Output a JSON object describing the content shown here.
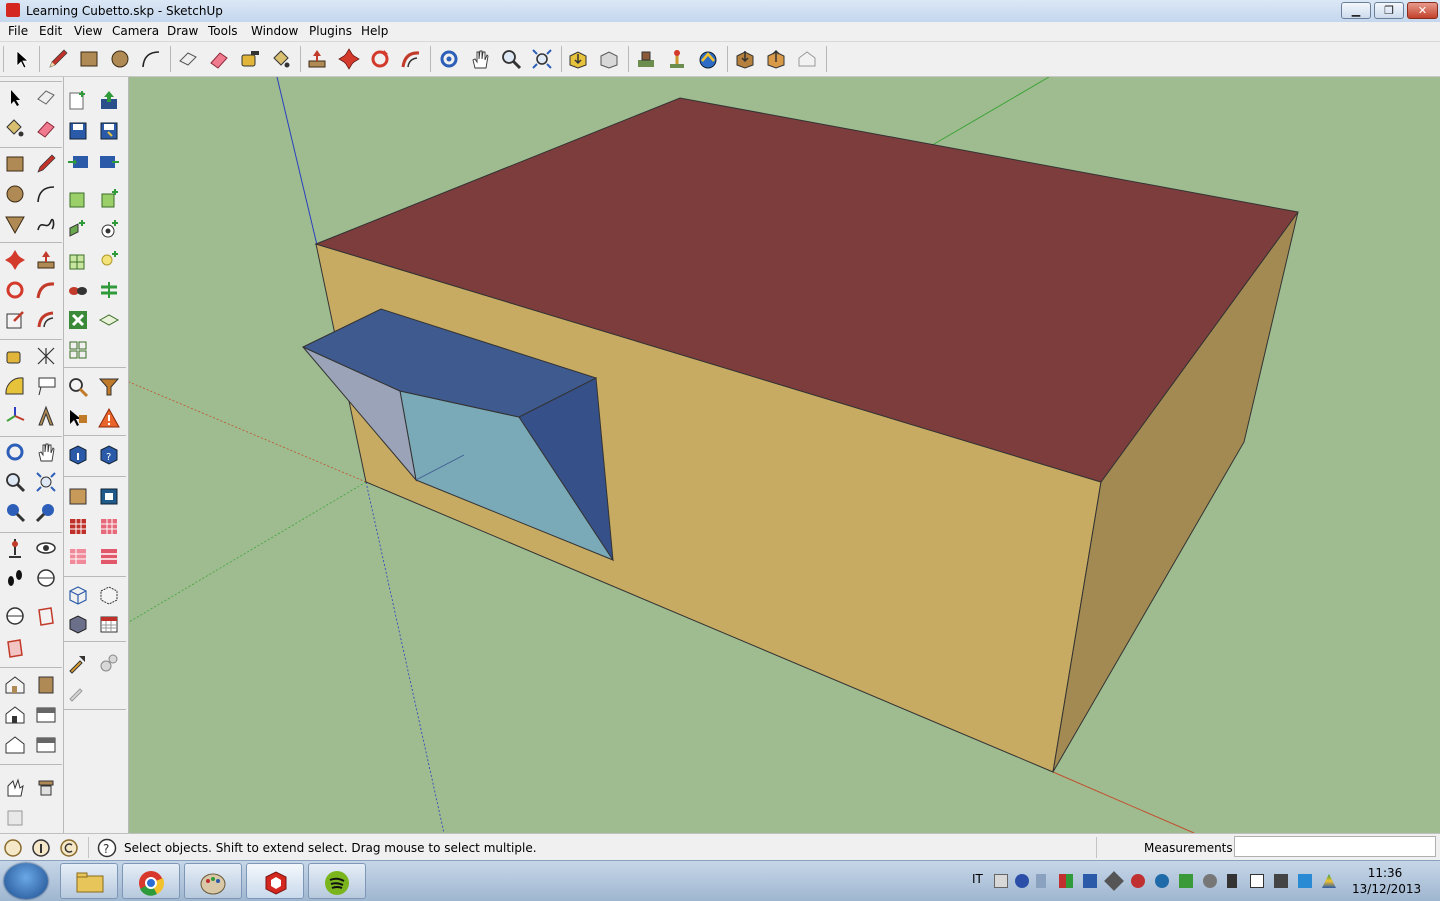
{
  "window": {
    "title": "Learning Cubetto.skp - SketchUp",
    "minimize_glyph": "▁",
    "maximize_glyph": "❐",
    "close_glyph": "✕"
  },
  "menu": {
    "items": [
      "File",
      "Edit",
      "View",
      "Camera",
      "Draw",
      "Tools",
      "Window",
      "Plugins",
      "Help"
    ]
  },
  "toolbar_top": {
    "icons": [
      "select-icon",
      "pencil-icon",
      "rectangle-icon",
      "circle-icon",
      "arc-icon",
      "make-component-icon",
      "eraser-icon",
      "tape-measure-icon",
      "paint-bucket-icon",
      "push-pull-icon",
      "move-icon",
      "rotate-icon",
      "follow-me-icon",
      "orbit-icon",
      "pan-icon",
      "zoom-icon",
      "zoom-extents-icon",
      "get-models-icon",
      "share-model-icon",
      "geo-location-icon",
      "add-location-icon",
      "google-earth-icon",
      "get-component-icon",
      "share-component-icon",
      "extension-icon"
    ]
  },
  "toolbar_left": {
    "tools": [
      "select",
      "make-component",
      "paint-bucket",
      "eraser",
      "rectangle",
      "line",
      "circle",
      "arc",
      "polygon",
      "freehand",
      "move",
      "push-pull",
      "rotate",
      "follow-me",
      "scale",
      "offset",
      "tape-measure",
      "dimension",
      "protractor",
      "text",
      "axes",
      "3d-text",
      "orbit",
      "pan",
      "zoom",
      "zoom-window",
      "previous",
      "next",
      "position-camera",
      "look-around",
      "walk",
      "section-plane",
      "display-section",
      "section-cut",
      "warehouse-model",
      "warehouse-share",
      "standard-view-iso",
      "standard-view-top",
      "standard-view-front",
      "standard-view-right",
      "sandbox-smoove",
      "sandbox-stamp"
    ],
    "plugins": [
      "new-model",
      "open-model",
      "save-model",
      "save-as",
      "import-idf",
      "export-idf",
      "new-zone",
      "new-zone-copy",
      "new-surface",
      "new-daylight-control",
      "new-space-grid",
      "new-illuminance-map",
      "shading-surface",
      "surface-matching",
      "inspector",
      "rendering-settings",
      "search",
      "filter",
      "pick-object",
      "error-warning",
      "info",
      "help",
      "zone-color",
      "space-color",
      "material-red",
      "material-pink",
      "material-light-red",
      "material-grid",
      "wireframe-view",
      "xray-view",
      "solid-view",
      "calendar-view",
      "tool-wrench",
      "tool-gears",
      "tool-extra"
    ]
  },
  "status": {
    "hint": "Select objects. Shift to extend select. Drag mouse to select multiple.",
    "measurements_label": "Measurements",
    "measurements_value": ""
  },
  "colors": {
    "viewport_bg": "#9ebc8f",
    "roof": "#7e3d3d",
    "wall_front": "#c8ab62",
    "wall_side": "#a28a52",
    "window_blue": "#3e5a8f",
    "window_blue_dark": "#36508a",
    "glass": "#7aa9b8",
    "window_gray": "#9aa3b8",
    "axis_red": "#c24f2f",
    "axis_green": "#3fa33a",
    "axis_blue": "#2b3fc0"
  },
  "taskbar": {
    "start_icon": "windows-start-icon",
    "apps": [
      "file-explorer-icon",
      "chrome-icon",
      "paint-icon",
      "sketchup-icon",
      "spotify-icon"
    ],
    "active_app": "sketchup-icon",
    "language": "IT",
    "time": "11:36",
    "date": "13/12/2013"
  }
}
